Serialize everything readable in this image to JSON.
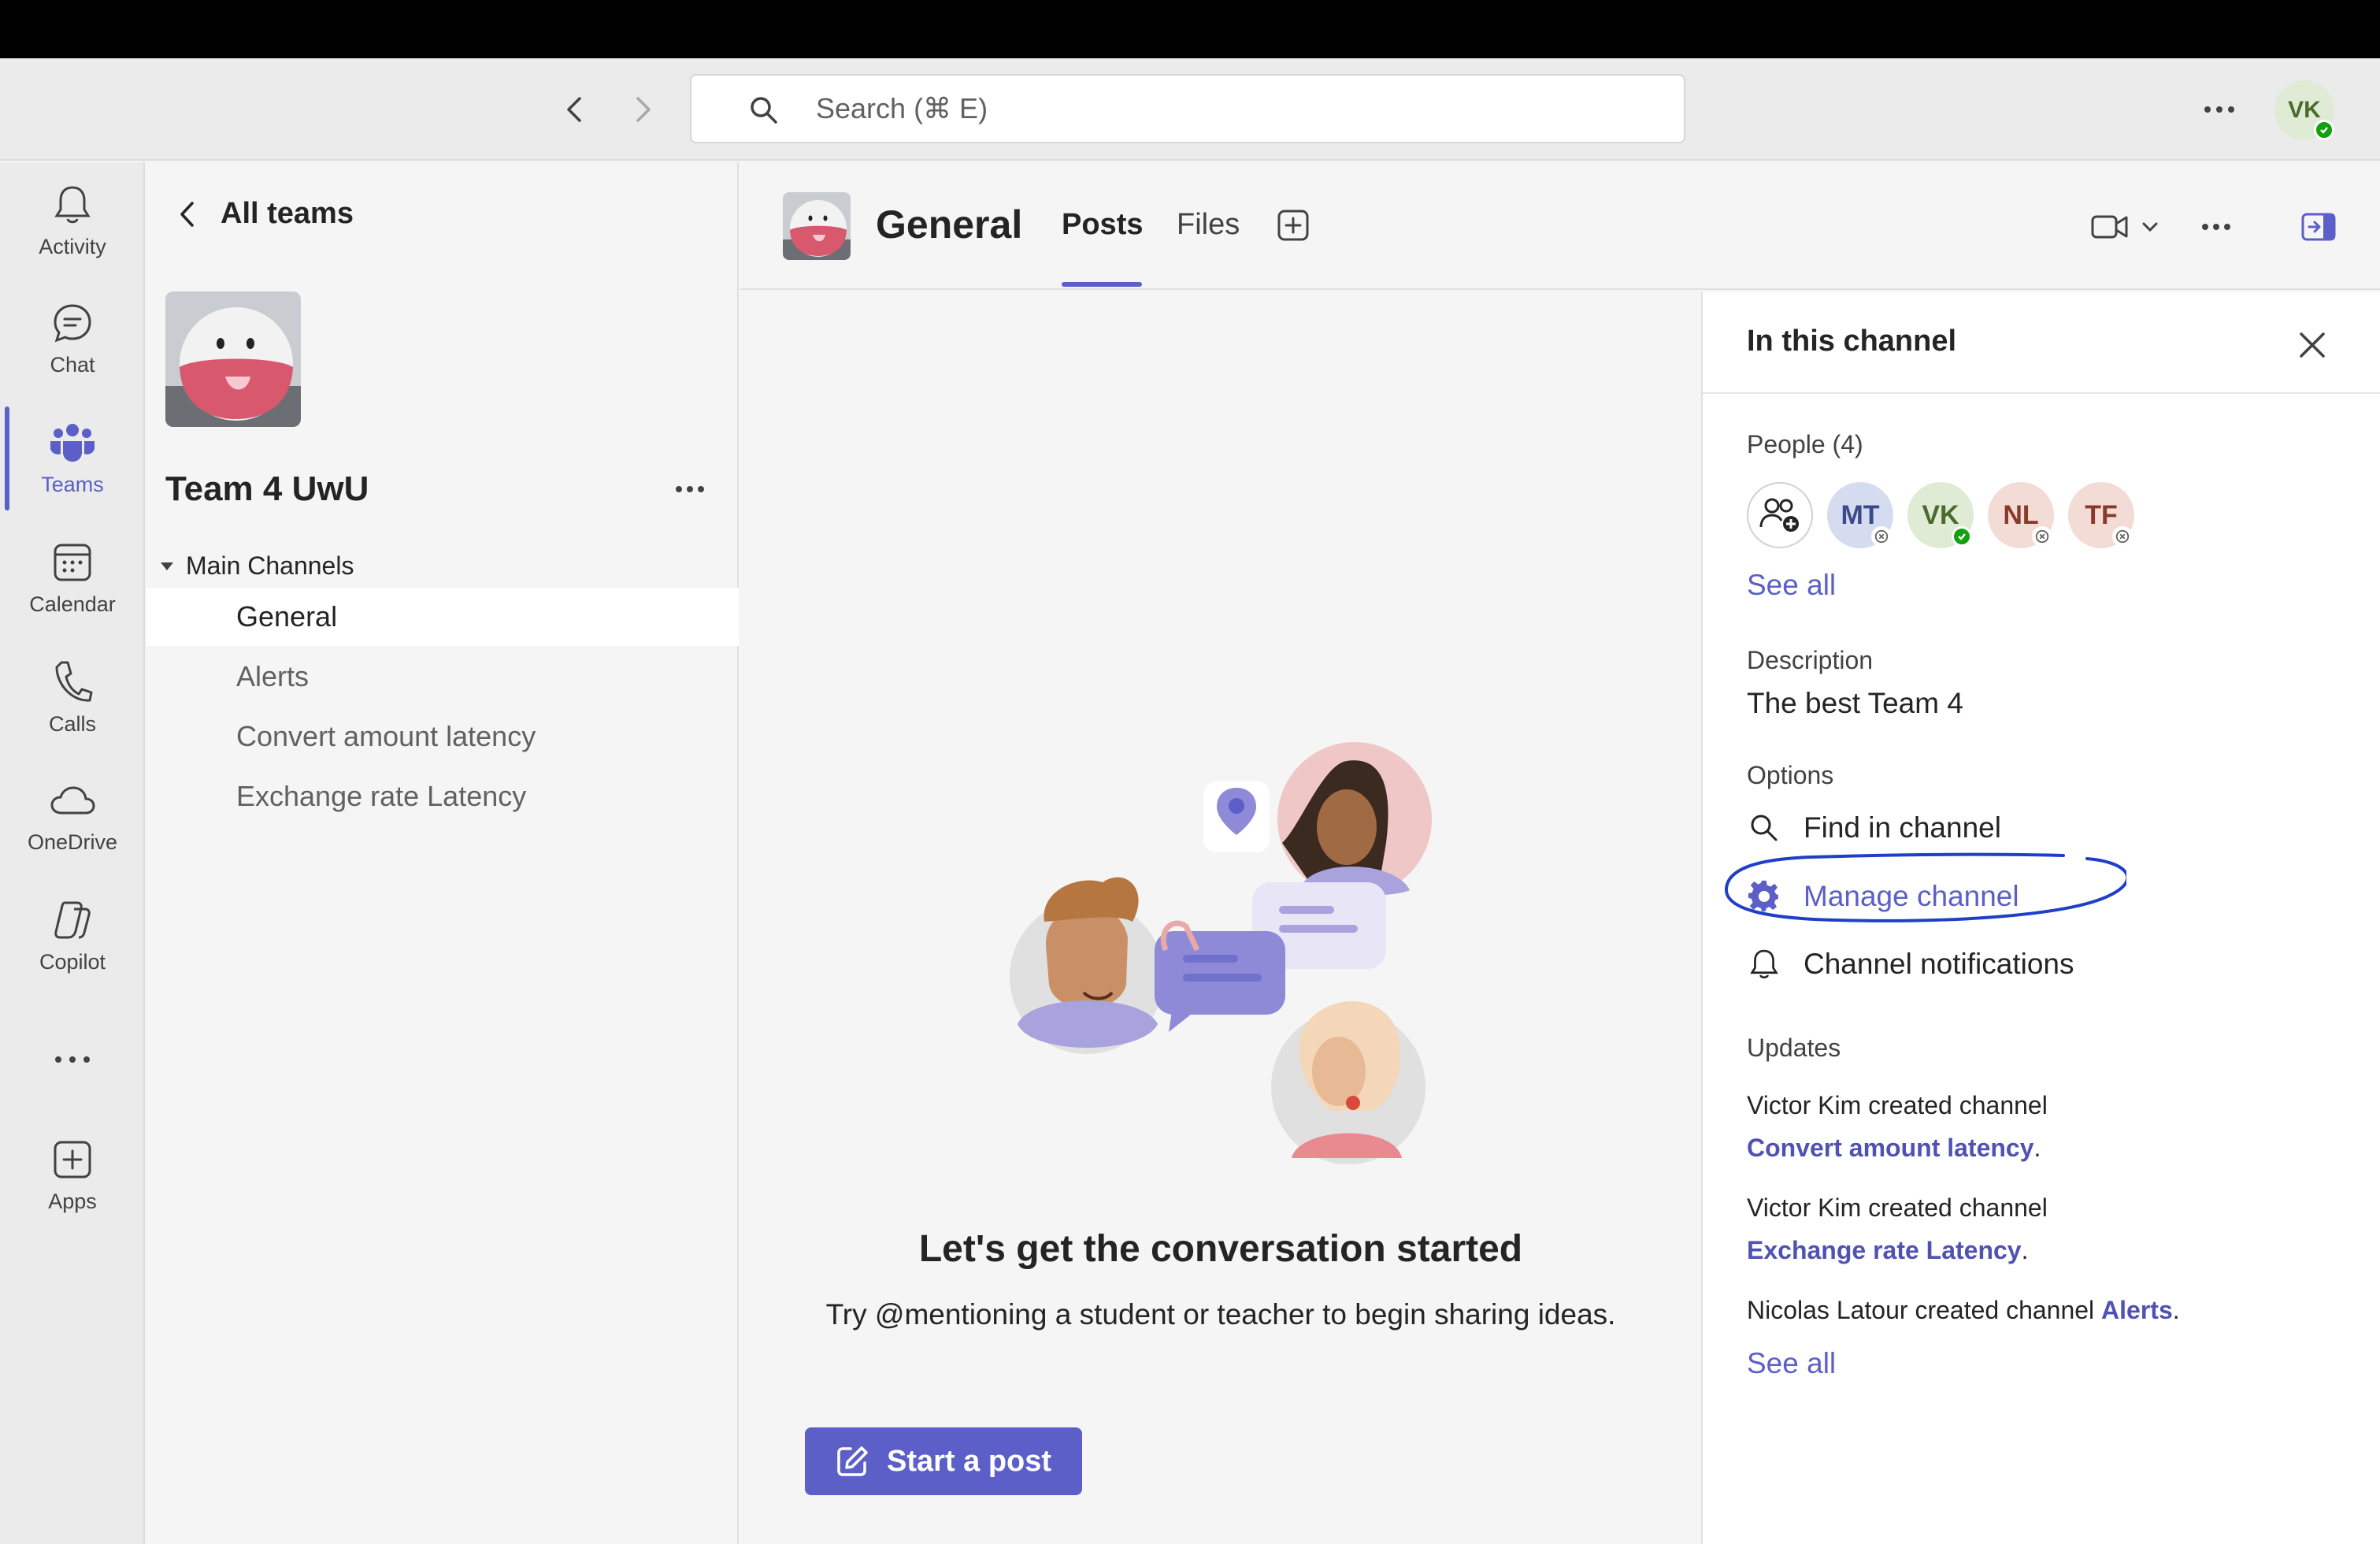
{
  "search": {
    "placeholder": "Search (⌘ E)"
  },
  "user": {
    "initials": "VK",
    "status_color": "#13a10e"
  },
  "rail": {
    "items": [
      {
        "label": "Activity",
        "icon": "bell-icon"
      },
      {
        "label": "Chat",
        "icon": "chat-icon"
      },
      {
        "label": "Teams",
        "icon": "teams-icon",
        "active": true
      },
      {
        "label": "Calendar",
        "icon": "calendar-icon"
      },
      {
        "label": "Calls",
        "icon": "phone-icon"
      },
      {
        "label": "OneDrive",
        "icon": "cloud-icon"
      },
      {
        "label": "Copilot",
        "icon": "copilot-icon"
      },
      {
        "label": "Apps",
        "icon": "plus-square-icon"
      }
    ]
  },
  "sidebar": {
    "back_label": "All teams",
    "team_name": "Team 4 UwU",
    "section_label": "Main Channels",
    "channels": [
      "General",
      "Alerts",
      "Convert amount latency",
      "Exchange rate Latency"
    ]
  },
  "header": {
    "channel_title": "General",
    "tabs": [
      "Posts",
      "Files"
    ]
  },
  "main": {
    "empty_title": "Let's get the conversation started",
    "empty_sub": "Try @mentioning a student or teacher to begin sharing ideas.",
    "start_post": "Start a post"
  },
  "panel": {
    "title": "In this channel",
    "people_label": "People (4)",
    "people": [
      {
        "initials": "MT",
        "bg": "#d6dcef",
        "fg": "#3a4a8a",
        "status": "offline"
      },
      {
        "initials": "VK",
        "bg": "#e0ebd6",
        "fg": "#4b6b2d",
        "status": "available"
      },
      {
        "initials": "NL",
        "bg": "#f4dcd6",
        "fg": "#8a3a2a",
        "status": "offline"
      },
      {
        "initials": "TF",
        "bg": "#f4dcd6",
        "fg": "#8a3a2a",
        "status": "offline"
      }
    ],
    "see_all": "See all",
    "description_label": "Description",
    "description": "The best Team 4",
    "options_label": "Options",
    "options": [
      "Find in channel",
      "Manage channel",
      "Channel notifications"
    ],
    "updates_label": "Updates",
    "updates": [
      {
        "prefix": "Victor Kim created channel",
        "channel": "Convert amount latency"
      },
      {
        "prefix": "Victor Kim created channel",
        "channel": "Exchange rate Latency"
      },
      {
        "prefix": "Nicolas Latour created channel",
        "channel": "Alerts"
      }
    ],
    "see_all_updates": "See all"
  },
  "colors": {
    "accent": "#5b5fc7",
    "annotation": "#1f3fc8"
  }
}
